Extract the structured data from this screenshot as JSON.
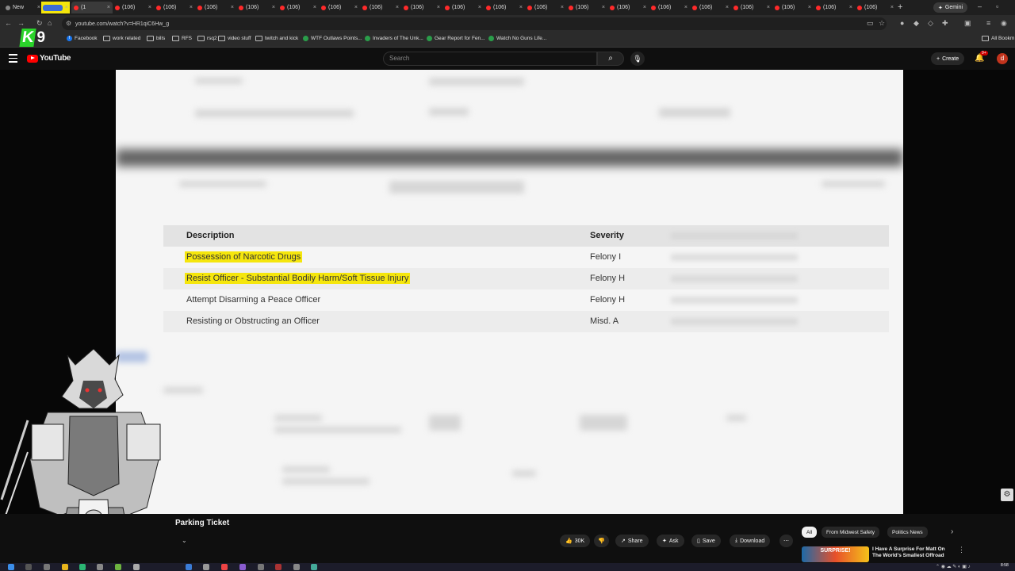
{
  "browser": {
    "tabs": [
      {
        "label": "New",
        "type": "new"
      },
      {
        "label": "",
        "type": "highlight"
      },
      {
        "label": "(1",
        "type": "active"
      },
      {
        "label": "(106)"
      },
      {
        "label": "(106)"
      },
      {
        "label": "(106)"
      },
      {
        "label": "(106)"
      },
      {
        "label": "(106)"
      },
      {
        "label": "(106)"
      },
      {
        "label": "(106)"
      },
      {
        "label": "(106)"
      },
      {
        "label": "(106)"
      },
      {
        "label": "(106)"
      },
      {
        "label": "(106)"
      },
      {
        "label": "(106)"
      },
      {
        "label": "(106)"
      },
      {
        "label": "(106)"
      },
      {
        "label": "(106)"
      },
      {
        "label": "(106)"
      },
      {
        "label": "(106)"
      },
      {
        "label": "(106)"
      },
      {
        "label": "(106)"
      }
    ],
    "gemini_label": "Gemini",
    "url": "youtube.com/watch?v=HR1qiC6Hw_g",
    "bookmarks": [
      {
        "label": "Facebook",
        "icon": "facebook-icon"
      },
      {
        "label": "work related",
        "icon": "folder-icon"
      },
      {
        "label": "bills",
        "icon": "folder-icon"
      },
      {
        "label": "RFS",
        "icon": "folder-icon"
      },
      {
        "label": "rsq2",
        "icon": "folder-icon"
      },
      {
        "label": "video stuff",
        "icon": "folder-icon"
      },
      {
        "label": "twitch and kick",
        "icon": "folder-icon"
      },
      {
        "label": "WTF Outlaws Points...",
        "icon": "site-icon"
      },
      {
        "label": "Invaders of The Unk...",
        "icon": "site-icon"
      },
      {
        "label": "Gear Report for Fen...",
        "icon": "site-icon"
      },
      {
        "label": "Watch No Guns Life...",
        "icon": "site-icon"
      }
    ],
    "all_bookmarks": "All Bookm"
  },
  "youtube": {
    "logo_text": "YouTube",
    "search_placeholder": "Search",
    "create_label": "Create",
    "notif_badge": "9+",
    "avatar_letter": "d"
  },
  "overlay": {
    "k9_k": "K",
    "k9_9": "9"
  },
  "document": {
    "columns": [
      "Description",
      "Severity"
    ],
    "rows": [
      {
        "description": "Possession of Narcotic Drugs",
        "severity": "Felony I",
        "highlighted": true
      },
      {
        "description": "Resist Officer - Substantial Bodily Harm/Soft Tissue Injury",
        "severity": "Felony H",
        "highlighted": true
      },
      {
        "description": "Attempt Disarming a Peace Officer",
        "severity": "Felony H",
        "highlighted": false
      },
      {
        "description": "Resisting or Obstructing an Officer",
        "severity": "Misd. A",
        "highlighted": false
      }
    ],
    "highlight_color": "#f5e60c"
  },
  "video_info": {
    "title": "Parking Ticket",
    "likes": "30K",
    "share": "Share",
    "ask": "Ask",
    "save": "Save",
    "download": "Download"
  },
  "chips": [
    "All",
    "From Midwest Safety",
    "Politics News"
  ],
  "recommendation": {
    "thumb_text": "SURPRISE!",
    "title": "I Have A Surprise For Matt On The World's Smallest Offroad"
  },
  "taskbar": {
    "clock": "8:58"
  }
}
